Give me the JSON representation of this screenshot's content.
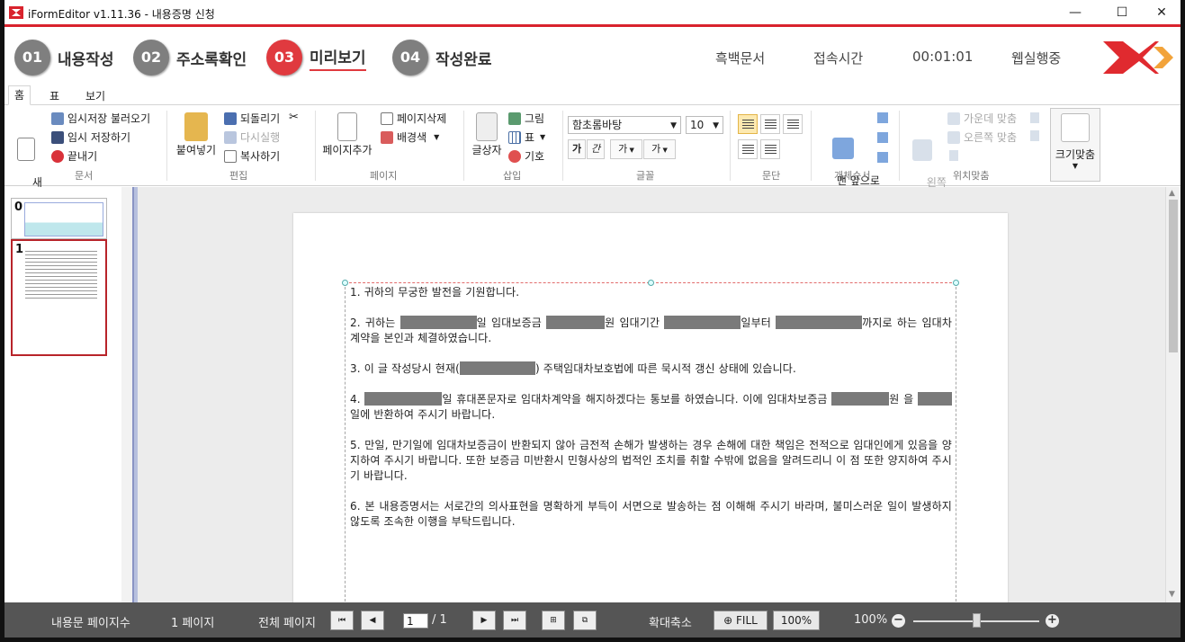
{
  "window": {
    "title": "iFormEditor v1.11.36 - 내용증명 신청",
    "minimize": "—",
    "maximize": "☐",
    "close": "✕"
  },
  "steps": [
    {
      "num": "01",
      "label": "내용작성",
      "active": false
    },
    {
      "num": "02",
      "label": "주소록확인",
      "active": false
    },
    {
      "num": "03",
      "label": "미리보기",
      "active": true
    },
    {
      "num": "04",
      "label": "작성완료",
      "active": false
    }
  ],
  "header_info": {
    "mode": "흑백문서",
    "time_label": "접속시간",
    "time_value": "00:01:01",
    "status": "웹실행중"
  },
  "ribbon_tabs": [
    "홈",
    "표",
    "보기"
  ],
  "ribbon": {
    "doc": {
      "new": "새\n문서",
      "load_temp": "임시저장 불러오기",
      "save_temp": "임시 저장하기",
      "exit": "끝내기",
      "label": "문서"
    },
    "edit": {
      "paste": "붙여넣기",
      "undo": "되돌리기",
      "redo": "다시실행",
      "copy": "복사하기",
      "label": "편집"
    },
    "page": {
      "add": "페이지추가",
      "delete": "페이지삭제",
      "bg": "배경색",
      "label": "페이지"
    },
    "insert": {
      "textbox": "글상자",
      "image": "그림",
      "table": "표",
      "symbol": "기호",
      "label": "삽입"
    },
    "font": {
      "family": "함초롬바탕",
      "size": "10",
      "bold": "가",
      "italic": "간",
      "color": "가",
      "highlight": "가",
      "label": "글꼴"
    },
    "paragraph": {
      "label": "문단"
    },
    "order": {
      "front": "맨 앞으로\n보내기",
      "label": "개체순서"
    },
    "position": {
      "left": "왼쪽\n맞춤",
      "center": "가운데 맞춤",
      "right": "오른쪽 맞춤",
      "label": "위치맞춤"
    },
    "fit": {
      "label": "크기맞춤"
    }
  },
  "thumbnails": [
    {
      "num": "0",
      "selected": false
    },
    {
      "num": "1",
      "selected": true
    }
  ],
  "document": {
    "p1": "1. 귀하의 무궁한 발전을 기원합니다.",
    "p2a": "2. 귀하는",
    "p2b": "일 임대보증금",
    "p2c": "원 임대기간",
    "p2d": "일부터",
    "p2e": "까지로 하는",
    "p2f": "임대차계약을 본인과 체결하였습니다.",
    "p3a": "3. 이 글 작성당시 현재(",
    "p3b": ") 주택임대차보호법에 따른 묵시적 갱신 상태에 있습니다.",
    "p4a": "4.",
    "p4b": "일 휴대폰문자로 임대차계약을 해지하겠다는 통보를 하였습니다. 이에 임대차보증금",
    "p4c": "원",
    "p4d": "을",
    "p4e": "일에 반환하여 주시기 바랍니다.",
    "p5": "5. 만일, 만기일에 임대차보증금이 반환되지 않아 금전적 손해가 발생하는 경우 손해에 대한 책임은 전적으로 임대인에게 있음을 양지하여 주시기 바랍니다. 또한 보증금 미반환시 민형사상의 법적인 조치를 취할 수밖에 없음을 알려드리니 이 점 또한 양지하여 주시기 바랍니다.",
    "p6": "6. 본 내용증명서는 서로간의 의사표현을 명확하게 부득이 서면으로 발송하는 점 이해해 주시기 바라며, 불미스러운 일이 발생하지 않도록 조속한 이행을 부탁드립니다."
  },
  "statusbar": {
    "content_pages_label": "내용문 페이지수",
    "content_pages_value": "1 페이지",
    "total_label": "전체 페이지",
    "current_page": "1",
    "total_pages": "/ 1",
    "zoom_label": "확대축소",
    "fill": "FILL",
    "zoom_box": "100%",
    "zoom_value": "100%",
    "zoom_fraction": 0.5
  },
  "colors": {
    "accent": "#e03a3f",
    "step_inactive": "#7f7f7f",
    "statusbar": "#555555"
  }
}
